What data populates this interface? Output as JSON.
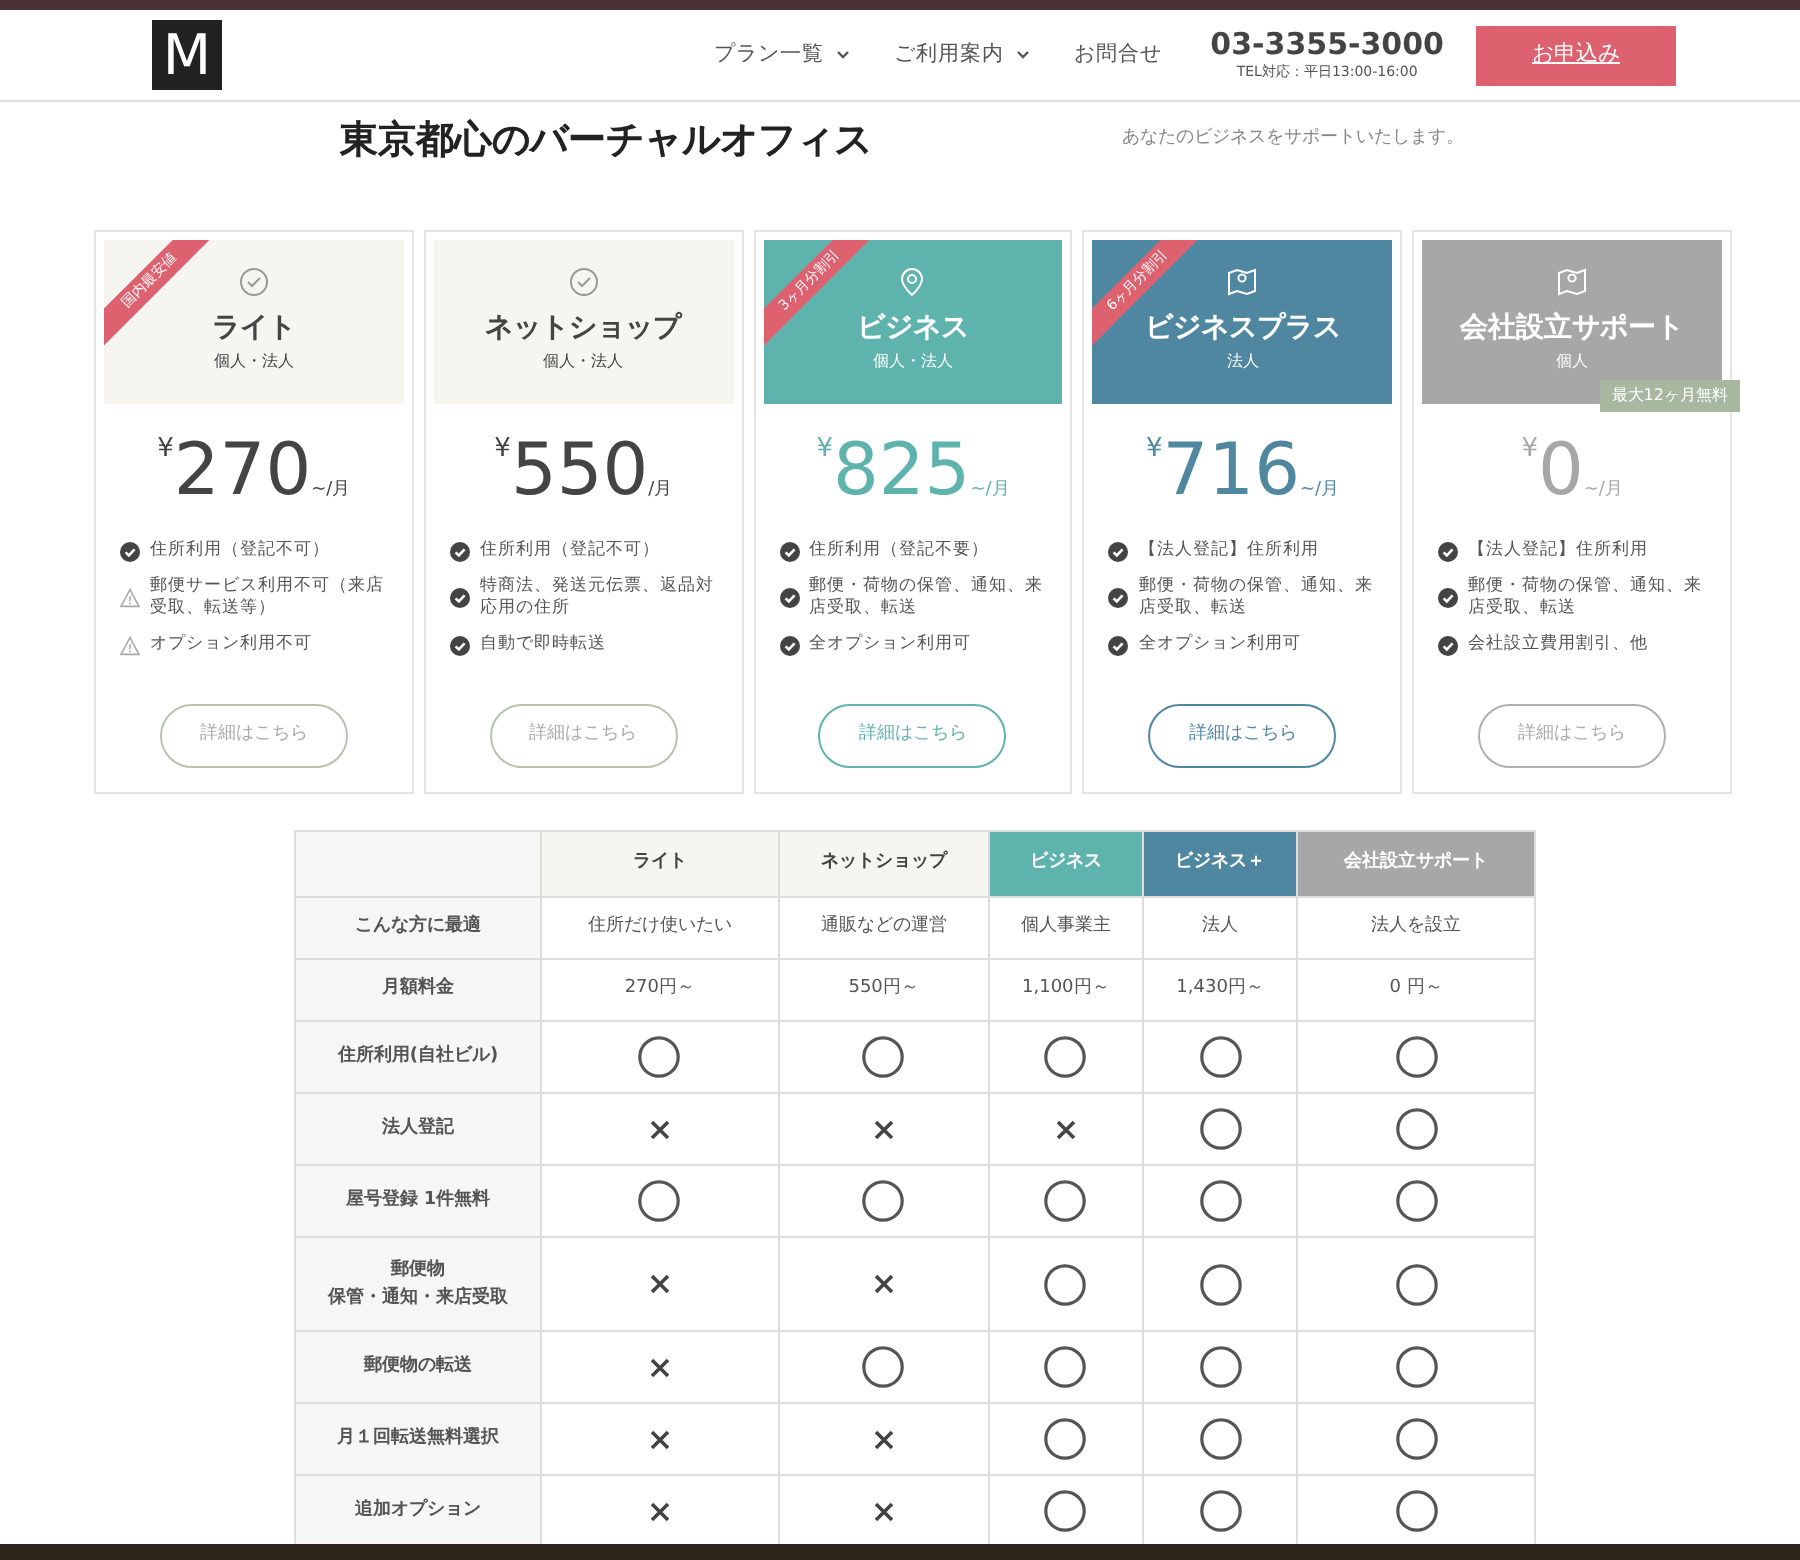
{
  "header": {
    "logo": "M",
    "nav": [
      {
        "label": "プラン一覧",
        "dropdown": true
      },
      {
        "label": "ご利用案内",
        "dropdown": true
      },
      {
        "label": "お問合せ",
        "dropdown": false
      }
    ],
    "phone": "03-3355-3000",
    "hours": "TEL対応：平日13:00-16:00",
    "cta": "お申込み"
  },
  "hero": {
    "title": "東京都心のバーチャルオフィス",
    "text": "あなたのビジネスをサポートいたします。"
  },
  "plans": [
    {
      "kind": "plain",
      "name": "ライト",
      "target": "個人・法人",
      "ribbon": "国内最安値",
      "currency": "¥",
      "price": "270",
      "unit": "~/月",
      "features": [
        {
          "kind": "check",
          "text": "住所利用（登記不可）"
        },
        {
          "kind": "warn",
          "text": "郵便サービス利用不可（来店受取、転送等）"
        },
        {
          "kind": "warn",
          "text": "オプション利用不可"
        }
      ],
      "button": "詳細はこちら"
    },
    {
      "kind": "plain",
      "name": "ネットショップ",
      "target": "個人・法人",
      "currency": "¥",
      "price": "550",
      "unit": "/月",
      "features": [
        {
          "kind": "check",
          "text": "住所利用（登記不可）"
        },
        {
          "kind": "check",
          "text": "特商法、発送元伝票、返品対応用の住所"
        },
        {
          "kind": "check",
          "text": "自動で即時転送"
        }
      ],
      "button": "詳細はこちら"
    },
    {
      "kind": "teal",
      "name": "ビジネス",
      "target": "個人・法人",
      "ribbon": "3ヶ月分割引",
      "currency": "¥",
      "price": "825",
      "unit": "~/月",
      "features": [
        {
          "kind": "check",
          "text": "住所利用（登記不要）"
        },
        {
          "kind": "check",
          "text": "郵便・荷物の保管、通知、来店受取、転送"
        },
        {
          "kind": "check",
          "text": "全オプション利用可"
        }
      ],
      "button": "詳細はこちら"
    },
    {
      "kind": "blue",
      "name": "ビジネスプラス",
      "target": "法人",
      "ribbon": "6ヶ月分割引",
      "currency": "¥",
      "price": "716",
      "unit": "~/月",
      "features": [
        {
          "kind": "check",
          "text": "【法人登記】住所利用"
        },
        {
          "kind": "check",
          "text": "郵便・荷物の保管、通知、来店受取、転送"
        },
        {
          "kind": "check",
          "text": "全オプション利用可"
        }
      ],
      "button": "詳細はこちら"
    },
    {
      "kind": "gray",
      "name": "会社設立サポート",
      "target": "個人",
      "badge": "最大12ヶ月無料",
      "currency": "¥",
      "price": "0",
      "unit": "~/月",
      "features": [
        {
          "kind": "check",
          "text": "【法人登記】住所利用"
        },
        {
          "kind": "check",
          "text": "郵便・荷物の保管、通知、来店受取、転送"
        },
        {
          "kind": "check",
          "text": "会社設立費用割引、他"
        }
      ],
      "button": "詳細はこちら"
    }
  ],
  "table": {
    "columns": [
      {
        "kind": "plain",
        "label": "ライト"
      },
      {
        "kind": "plain",
        "label": "ネットショップ"
      },
      {
        "kind": "teal",
        "label": "ビジネス"
      },
      {
        "kind": "blue",
        "label": "ビジネス＋"
      },
      {
        "kind": "gray",
        "label": "会社設立サポート"
      }
    ],
    "rows": [
      {
        "label": "こんな方に最適",
        "cells": [
          {
            "kind": "text",
            "text": "住所だけ使いたい"
          },
          {
            "kind": "text",
            "text": "通販などの運営"
          },
          {
            "kind": "text",
            "text": "個人事業主"
          },
          {
            "kind": "text",
            "text": "法人"
          },
          {
            "kind": "text",
            "text": "法人を設立"
          }
        ]
      },
      {
        "label": "月額料金",
        "cells": [
          {
            "kind": "text",
            "text": "270円～"
          },
          {
            "kind": "text",
            "text": "550円～"
          },
          {
            "kind": "text",
            "text": "1,100円～"
          },
          {
            "kind": "text",
            "text": "1,430円～"
          },
          {
            "kind": "text",
            "text": "0 円～"
          }
        ]
      },
      {
        "label": "住所利用(自社ビル)",
        "cells": [
          {
            "kind": "circle"
          },
          {
            "kind": "circle"
          },
          {
            "kind": "circle"
          },
          {
            "kind": "circle"
          },
          {
            "kind": "circle"
          }
        ]
      },
      {
        "label": "法人登記",
        "cells": [
          {
            "kind": "cross"
          },
          {
            "kind": "cross"
          },
          {
            "kind": "cross"
          },
          {
            "kind": "circle"
          },
          {
            "kind": "circle"
          }
        ]
      },
      {
        "label": "屋号登録 1件無料",
        "cells": [
          {
            "kind": "circle"
          },
          {
            "kind": "circle"
          },
          {
            "kind": "circle"
          },
          {
            "kind": "circle"
          },
          {
            "kind": "circle"
          }
        ]
      },
      {
        "label": [
          "郵便物",
          "保管・通知・来店受取"
        ],
        "cells": [
          {
            "kind": "cross"
          },
          {
            "kind": "cross"
          },
          {
            "kind": "circle"
          },
          {
            "kind": "circle"
          },
          {
            "kind": "circle"
          }
        ]
      },
      {
        "label": "郵便物の転送",
        "cells": [
          {
            "kind": "cross"
          },
          {
            "kind": "circle"
          },
          {
            "kind": "circle"
          },
          {
            "kind": "circle"
          },
          {
            "kind": "circle"
          }
        ]
      },
      {
        "label": "月１回転送無料選択",
        "cells": [
          {
            "kind": "cross"
          },
          {
            "kind": "cross"
          },
          {
            "kind": "circle"
          },
          {
            "kind": "circle"
          },
          {
            "kind": "circle"
          }
        ]
      },
      {
        "label": "追加オプション",
        "cells": [
          {
            "kind": "cross"
          },
          {
            "kind": "cross"
          },
          {
            "kind": "circle"
          },
          {
            "kind": "circle"
          },
          {
            "kind": "circle"
          }
        ]
      }
    ]
  }
}
